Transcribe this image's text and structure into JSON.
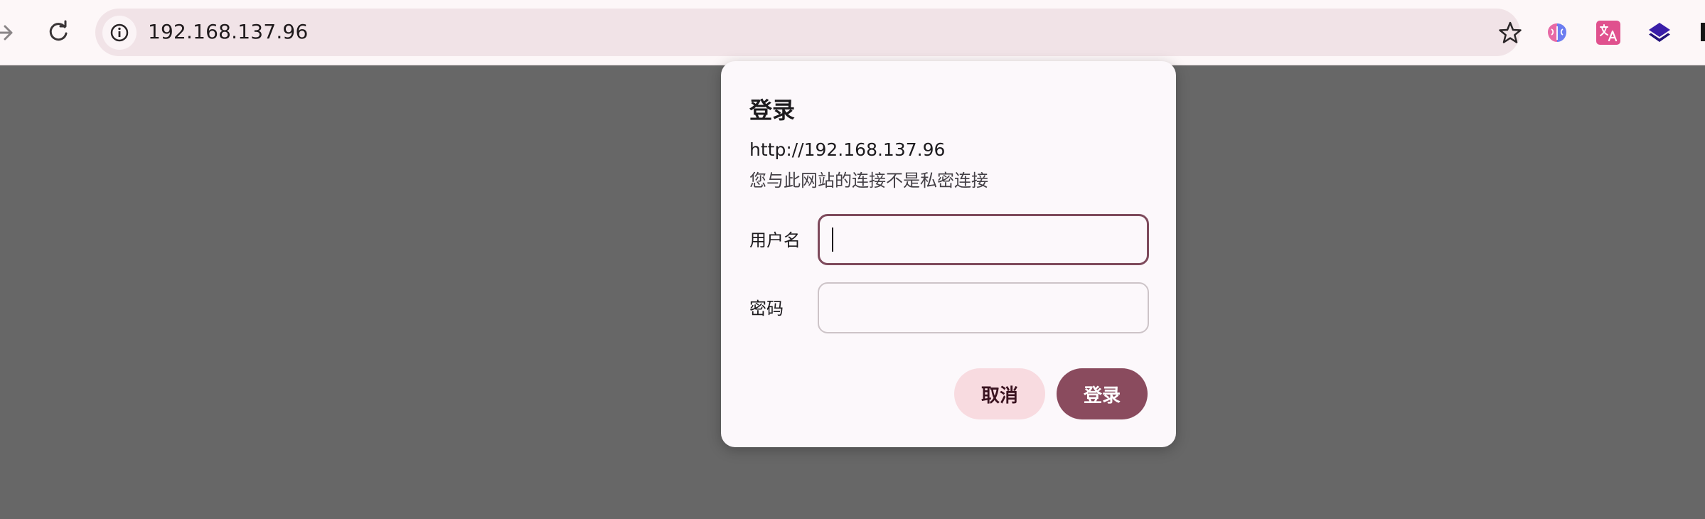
{
  "browser": {
    "url": "192.168.137.96",
    "icons": {
      "forward": "arrow-forward-icon",
      "reload": "reload-icon",
      "site_info": "info-icon",
      "bookmark": "star-icon",
      "extensions": [
        "brain-extension-icon",
        "translate-extension-icon",
        "layers-extension-icon"
      ]
    }
  },
  "dialog": {
    "title": "登录",
    "url": "http://192.168.137.96",
    "note": "您与此网站的连接不是私密连接",
    "username_label": "用户名",
    "username_value": "",
    "password_label": "密码",
    "password_value": "",
    "cancel_label": "取消",
    "submit_label": "登录"
  },
  "colors": {
    "accent": "#8a4b5e",
    "cancel_bg": "#f8dbe0",
    "overlay": "#676767"
  }
}
